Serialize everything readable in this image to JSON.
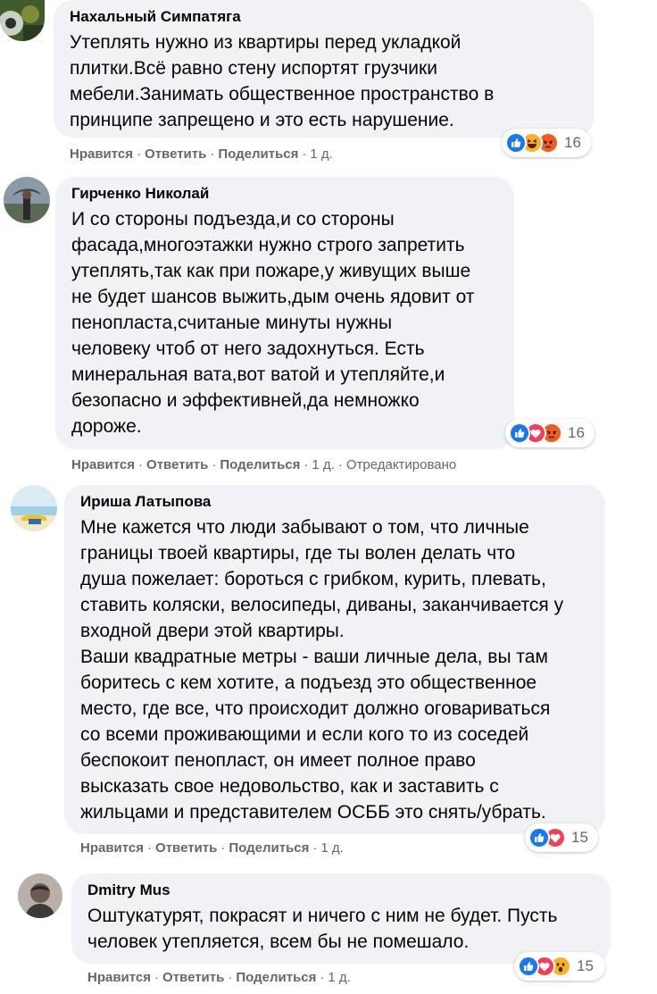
{
  "comments": [
    {
      "author": "Нахальный Симпатяга",
      "text": "Утеплять нужно из квартиры перед укладкой\nплитки.Всё равно стену испортят грузчики\nмебели.Занимать общественное пространство в\nпринципе запрещено и это есть нарушение.",
      "like_label": "Нравится",
      "reply_label": "Ответить",
      "share_label": "Поделиться",
      "time": "1 д.",
      "edited": "",
      "reactions": [
        "like",
        "haha",
        "angry"
      ],
      "reaction_count": "16"
    },
    {
      "author": "Гирченко Николай",
      "text": "И со стороны подъезда,и со стороны\nфасада,многоэтажки нужно строго запретить\nутеплять,так как при пожаре,у живущих выше\nне будет шансов выжить,дым очень ядовит от\nпенопласта,считаные минуты нужны\nчеловеку чтоб от него задохнуться. Есть\nминеральная вата,вот ватой и утепляйте,и\nбезопасно и эффективней,да немножко\nдороже.",
      "like_label": "Нравится",
      "reply_label": "Ответить",
      "share_label": "Поделиться",
      "time": "1 д.",
      "edited": "Отредактировано",
      "reactions": [
        "like",
        "love",
        "angry"
      ],
      "reaction_count": "16"
    },
    {
      "author": "Ириша Латыпова",
      "text": "Мне кажется что люди забывают о том, что личные\nграницы твоей квартиры, где ты волен делать что\nдуша пожелает: бороться с грибком, курить, плевать,\nставить коляски, велосипеды, диваны, заканчивается у\nвходной двери этой квартиры.\nВаши квадратные метры - ваши личные дела, вы там\nборитесь с кем хотите, а подъезд это общественное\nместо, где все, что происходит должно оговариваться\nсо всеми проживающими и если кого то из соседей\nбеспокоит пенопласт, он имеет полное право\nвысказать свое недовольство, как и заставить с\nжильцами и представителем ОСББ это снять/убрать.",
      "like_label": "Нравится",
      "reply_label": "Ответить",
      "share_label": "Поделиться",
      "time": "1 д.",
      "edited": "",
      "reactions": [
        "like",
        "love"
      ],
      "reaction_count": "15"
    },
    {
      "author": "Dmitry Mus",
      "text": "Оштукатурят, покрасят и ничего с ним не будет. Пусть\nчеловек утепляется, всем бы не помешало.",
      "like_label": "Нравится",
      "reply_label": "Ответить",
      "share_label": "Поделиться",
      "time": "1 д.",
      "edited": "",
      "reactions": [
        "like",
        "love",
        "wow"
      ],
      "reaction_count": "15"
    }
  ],
  "separator": "·",
  "colors": {
    "bubble": "#f0f2f5",
    "meta_text": "#65676b",
    "like": "#1877f2",
    "love": "#f33e58",
    "angry": "#e9710f",
    "haha": "#f7b125"
  }
}
